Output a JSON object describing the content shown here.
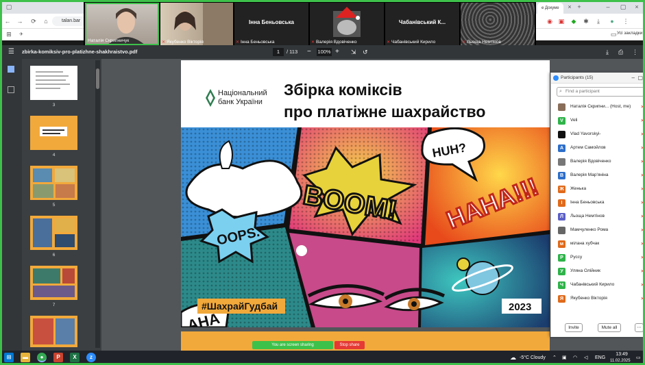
{
  "browser": {
    "url": "talan.bar",
    "tab_right": "е Докуме",
    "bookmarks_right": "Усі закладки"
  },
  "video_strip": {
    "tiles": [
      {
        "name": "Наталія Скрипничук",
        "center": ""
      },
      {
        "name": "Якубенко Вікторія",
        "center": ""
      },
      {
        "name": "Інна Беньовська",
        "center": "Інна Беньовська"
      },
      {
        "name": "Валерія Вдовіченко",
        "center": ""
      },
      {
        "name": "Чабанівський Кирило",
        "center": "Чабанівський К..."
      },
      {
        "name": "Льоща Немтінов",
        "center": ""
      }
    ]
  },
  "pdf": {
    "filename": "zbirka-komiksiv-pro-platizhne-shakhraistvo.pdf",
    "page_current": "1",
    "page_total": "/ 113",
    "zoom": "100%",
    "thumbnails": [
      "3",
      "4",
      "5",
      "6",
      "7"
    ],
    "bank_name_line1": "Національний",
    "bank_name_line2": "банк України",
    "title_line1": "Збірка коміксів",
    "title_line2": "про платіжне шахрайство",
    "hashtag": "#ШахрайГудбай",
    "year": "2023",
    "comic_words": {
      "boom": "BOOM!",
      "haha": "HAHA!!!",
      "huh": "HUH?",
      "oops": "OOPS.",
      "aha": "AHA"
    }
  },
  "participants": {
    "header": "Participants (15)",
    "search_placeholder": "Find a participant",
    "list": [
      {
        "initial": "",
        "name": "Наталія Скрипни... (Host, me)",
        "color": "#8a6e5a"
      },
      {
        "initial": "V",
        "name": "Veli",
        "color": "#2fb34a"
      },
      {
        "initial": "",
        "name": "Vlad Yavorskyi-",
        "color": "#111111"
      },
      {
        "initial": "А",
        "name": "Артем Самойлов",
        "color": "#2d6ec9"
      },
      {
        "initial": "",
        "name": "Валерія Вдовіченко",
        "color": "#777777"
      },
      {
        "initial": "В",
        "name": "Валерія Мар'яніна",
        "color": "#2d6ec9"
      },
      {
        "initial": "Ж",
        "name": "Женька",
        "color": "#e06a1b"
      },
      {
        "initial": "І",
        "name": "Інна Беньовська",
        "color": "#e06a1b"
      },
      {
        "initial": "Л",
        "name": "Льоща Немтінов",
        "color": "#5b5fc7"
      },
      {
        "initial": "",
        "name": "Мамчуленко Рома",
        "color": "#666666"
      },
      {
        "initial": "м",
        "name": "мілана хубчак",
        "color": "#e06a1b"
      },
      {
        "initial": "Р",
        "name": "Руссу",
        "color": "#2fb34a"
      },
      {
        "initial": "У",
        "name": "Уляна Олійник",
        "color": "#2fb34a"
      },
      {
        "initial": "Ч",
        "name": "Чабанівський Кирило",
        "color": "#2fb34a"
      },
      {
        "initial": "Я",
        "name": "Якубенко Вікторія",
        "color": "#e06a1b"
      }
    ],
    "invite": "Invite",
    "mute_all": "Mute all"
  },
  "share": {
    "status": "You are screen sharing",
    "stop": "Stop share"
  },
  "taskbar": {
    "weather": "-5°C  Cloudy",
    "lang": "ENG",
    "time": "13:49",
    "date": "11.02.2025"
  },
  "colors": {
    "share_green": "#3ec14b",
    "stop_red": "#e53935",
    "pdf_toolbar": "#323639",
    "nbu_orange": "#f2a93b"
  }
}
